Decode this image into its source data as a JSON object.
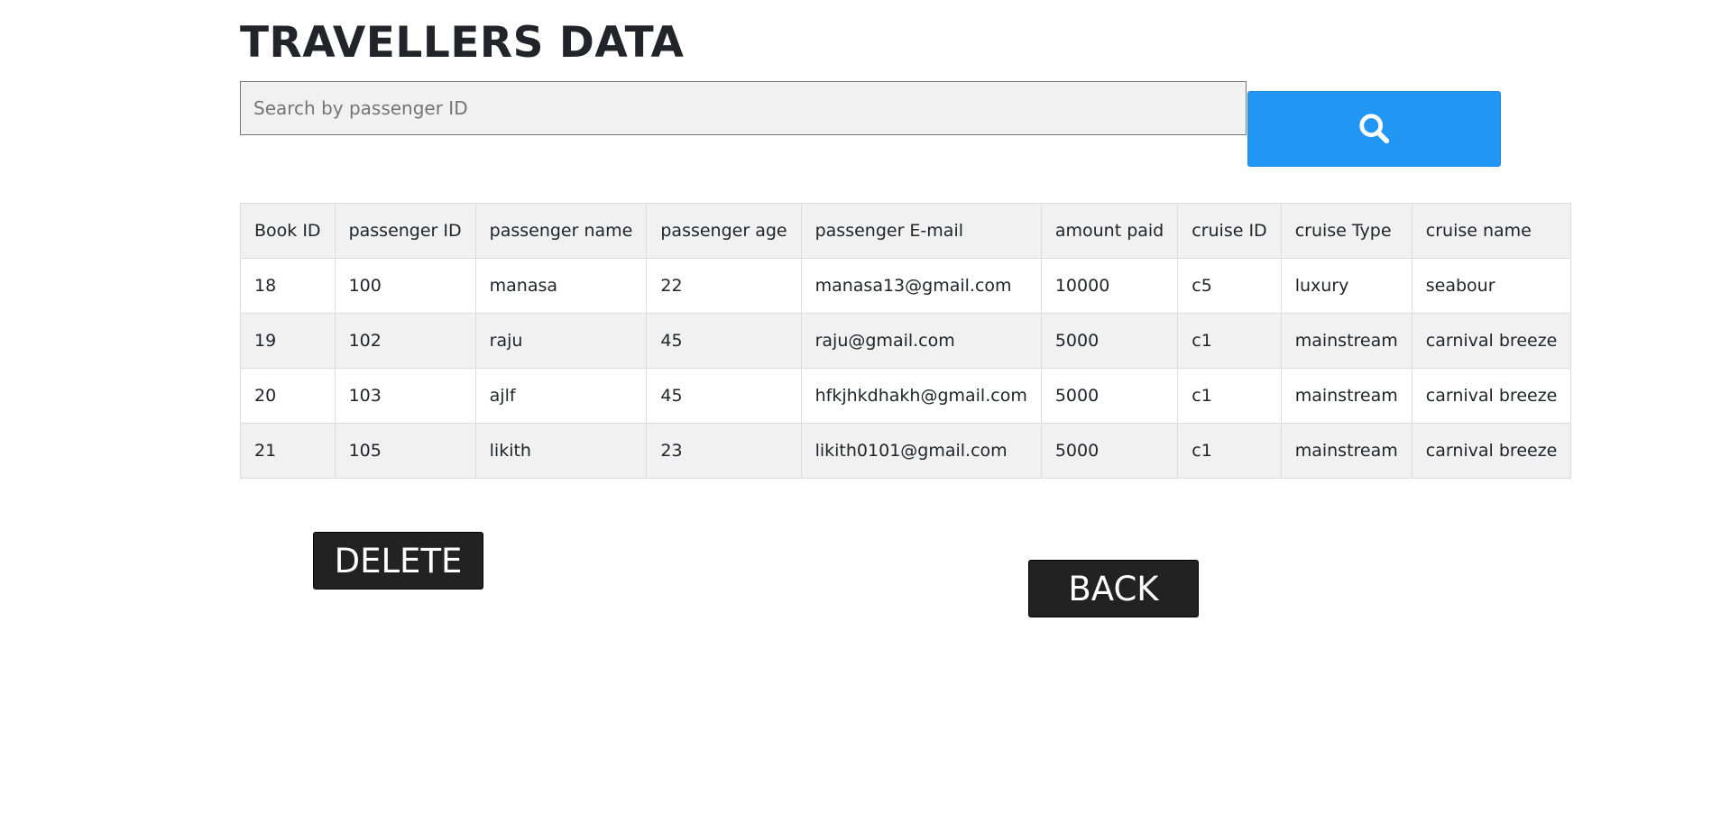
{
  "header": {
    "title": "TRAVELLERS DATA"
  },
  "search": {
    "placeholder": "Search by passenger ID",
    "icon": "search-icon",
    "button_color": "#2196f3"
  },
  "table": {
    "columns": [
      "Book ID",
      "passenger ID",
      "passenger name",
      "passenger age",
      "passenger E-mail",
      "amount paid",
      "cruise ID",
      "cruise Type",
      "cruise name"
    ],
    "rows": [
      [
        "18",
        "100",
        "manasa",
        "22",
        "manasa13@gmail.com",
        "10000",
        "c5",
        "luxury",
        "seabour"
      ],
      [
        "19",
        "102",
        "raju",
        "45",
        "raju@gmail.com",
        "5000",
        "c1",
        "mainstream",
        "carnival breeze"
      ],
      [
        "20",
        "103",
        "ajlf",
        "45",
        "hfkjhkdhakh@gmail.com",
        "5000",
        "c1",
        "mainstream",
        "carnival breeze"
      ],
      [
        "21",
        "105",
        "likith",
        "23",
        "likith0101@gmail.com",
        "5000",
        "c1",
        "mainstream",
        "carnival breeze"
      ]
    ]
  },
  "actions": {
    "delete_label": "DELETE",
    "back_label": "BACK"
  }
}
